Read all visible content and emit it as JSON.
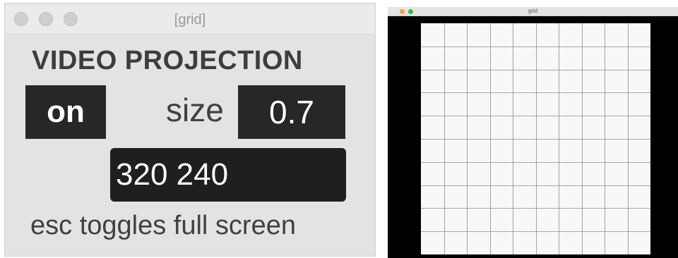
{
  "left_window": {
    "title": "[grid]",
    "heading": "VIDEO PROJECTION",
    "toggle_label": "on",
    "size_label": "size",
    "size_value": "0.7",
    "message_value": "320 240",
    "hint": "esc toggles full screen"
  },
  "right_window": {
    "title": "grid",
    "grid": {
      "columns": 10,
      "rows": 10,
      "line_color": "#8c8c8c"
    }
  },
  "colors": {
    "close_dot": "#f4a33b",
    "zoom_dot": "#2cc241",
    "box_bg": "#272727"
  }
}
